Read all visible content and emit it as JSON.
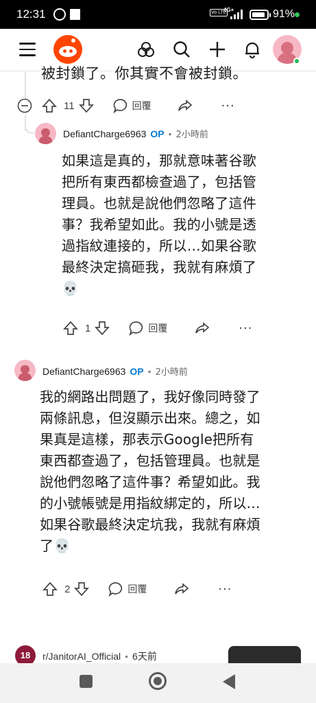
{
  "status_bar": {
    "time": "12:31",
    "volte": "Vo LTE",
    "network": "4G+",
    "battery": "91%"
  },
  "app_bar": {
    "icons": [
      "menu-icon",
      "reddit-logo",
      "communities-icon",
      "search-icon",
      "create-icon",
      "notifications-icon",
      "user-avatar"
    ]
  },
  "parent_comment": {
    "cut_text": "被封鎖了。你其實不會被封鎖。",
    "upvotes": "11",
    "reply_label": "回覆"
  },
  "comments": [
    {
      "username": "DefiantCharge6963",
      "op_badge": "OP",
      "separator": "•",
      "time": "2小時前",
      "body_lines": [
        "如果這是真的，那就意味著谷歌",
        "把所有東西都檢查過了，包括管",
        "理員。也就是說他們忽略了這件",
        "事？我希望如此。我的小號是透",
        "過指紋連接的，所以…如果谷歌",
        "最終決定搞砸我，我就有麻煩了",
        "💀"
      ],
      "upvotes": "1",
      "reply_label": "回覆"
    },
    {
      "username": "DefiantCharge6963",
      "op_badge": "OP",
      "separator": "•",
      "time": "2小時前",
      "body_lines": [
        "我的網路出問題了，我好像同時發了",
        "兩條訊息，但沒顯示出來。總之，如",
        "果真是這樣，那表示Google把所有",
        "東西都查過了，包括管理員。也就是",
        "說他們忽略了這件事？希望如此。我",
        "的小號帳號是用指紋綁定的，所以…",
        "如果谷歌最終決定坑我，我就有麻煩",
        "了💀"
      ],
      "upvotes": "2",
      "reply_label": "回覆"
    }
  ],
  "next_post": {
    "avatar_text": "18",
    "subreddit": "r/JanitorAI_Official",
    "separator": "•",
    "time": "6天前"
  }
}
